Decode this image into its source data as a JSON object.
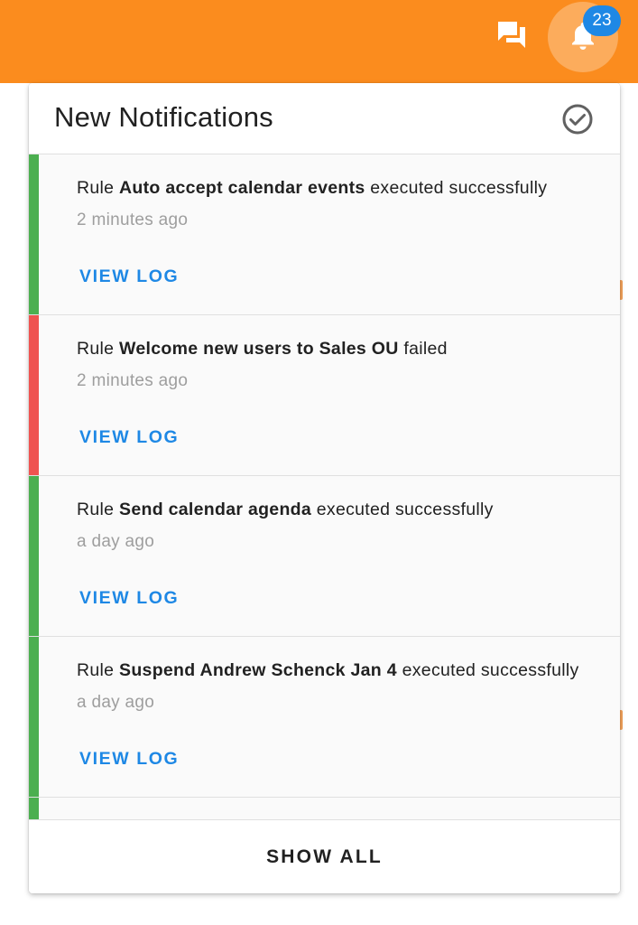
{
  "topbar": {
    "background": "#fb8c1e",
    "chat_icon": "chat-bubbles-icon",
    "bell_icon": "bell-icon",
    "badge_count": "23",
    "badge_color": "#1e88e5"
  },
  "panel": {
    "title": "New Notifications",
    "mark_read_icon": "check-circle-icon",
    "show_all_label": "SHOW ALL"
  },
  "notifications": [
    {
      "prefix": "Rule ",
      "rule": "Auto accept calendar events",
      "suffix": " executed successfully",
      "time": "2 minutes ago",
      "action": "VIEW LOG",
      "status": "success",
      "status_color": "#4caf50"
    },
    {
      "prefix": "Rule ",
      "rule": "Welcome new users to Sales OU",
      "suffix": " failed",
      "time": "2 minutes ago",
      "action": "VIEW LOG",
      "status": "failed",
      "status_color": "#ef5350"
    },
    {
      "prefix": "Rule ",
      "rule": "Send calendar agenda",
      "suffix": " executed successfully",
      "time": "a day ago",
      "action": "VIEW LOG",
      "status": "success",
      "status_color": "#4caf50"
    },
    {
      "prefix": "Rule ",
      "rule": "Suspend Andrew Schenck Jan 4",
      "suffix": " executed successfully",
      "time": "a day ago",
      "action": "VIEW LOG",
      "status": "success",
      "status_color": "#4caf50"
    }
  ],
  "partial_item": {
    "status_color": "#4caf50"
  }
}
